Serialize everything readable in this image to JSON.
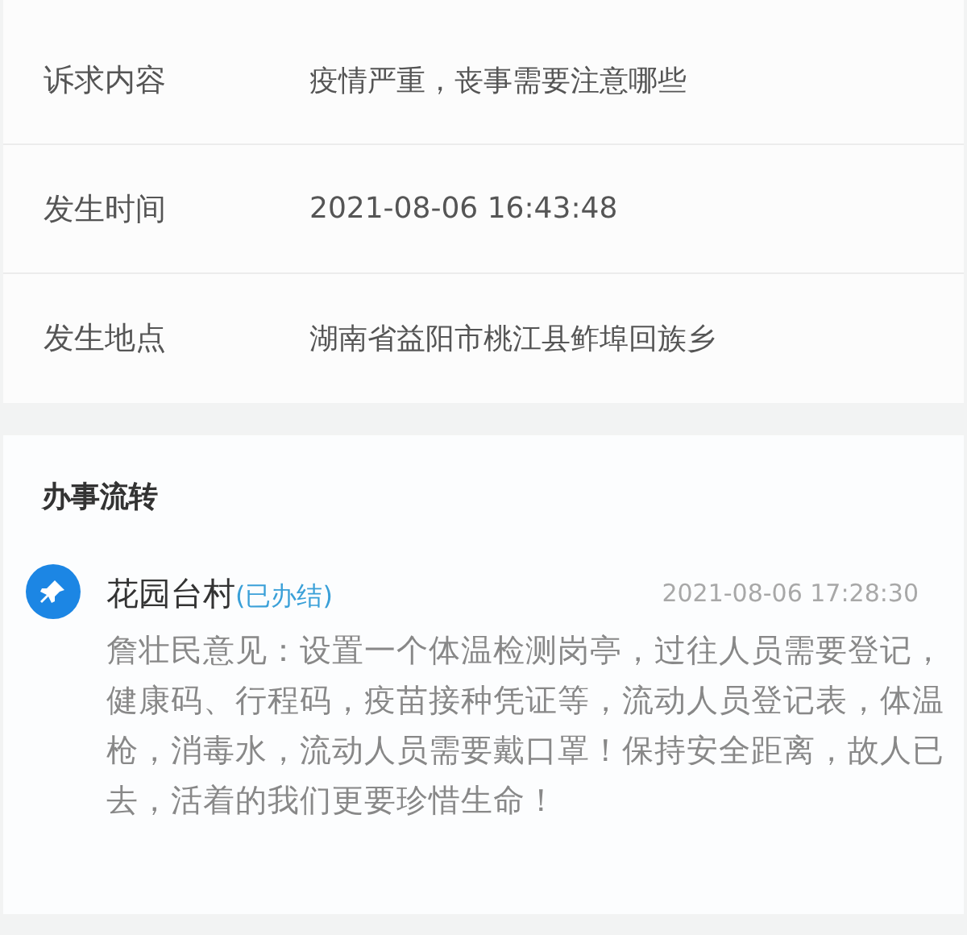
{
  "fields": [
    {
      "label": "诉求内容",
      "value": "疫情严重，丧事需要注意哪些"
    },
    {
      "label": "发生时间",
      "value": "2021-08-06 16:43:48"
    },
    {
      "label": "发生地点",
      "value": "湖南省益阳市桃江县鲊埠回族乡"
    }
  ],
  "process": {
    "title": "办事流转",
    "items": [
      {
        "name": "花园台村",
        "status": "(已办结)",
        "time": "2021-08-06 17:28:30",
        "text": "詹壮民意见：设置一个体温检测岗亭，过往人员需要登记，健康码、行程码，疫苗接种凭证等，流动人员登记表，体温枪，消毒水，流动人员需要戴口罩！保持安全距离，故人已去，活着的我们更要珍惜生命！"
      }
    ]
  }
}
